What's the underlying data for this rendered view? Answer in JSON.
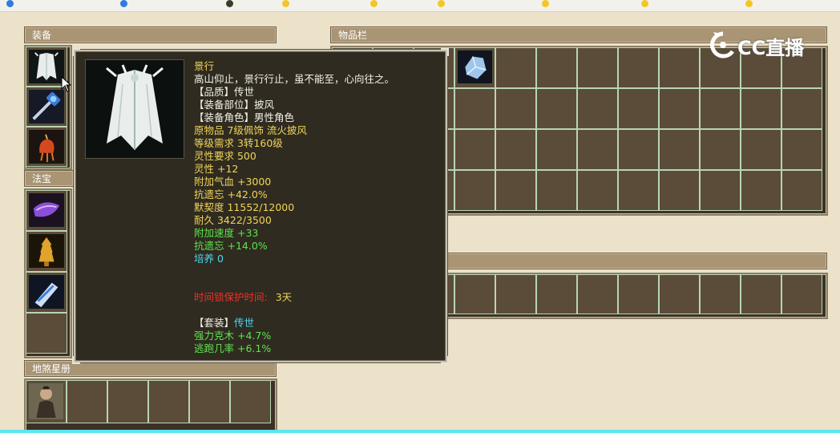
{
  "bookmarks": [
    "",
    "",
    "",
    "",
    "",
    "",
    "",
    "",
    "",
    ""
  ],
  "panels": {
    "equip_title": "装备",
    "fabao_title": "法宝",
    "disha_title": "地煞星册",
    "inventory_title": "物品栏"
  },
  "watermark": "CC直播",
  "tooltip": {
    "name": "景行",
    "desc": "高山仰止，景行行止，虽不能至，心向往之。",
    "quality": "【品质】传世",
    "slot": "【装备部位】披风",
    "role": "【装备角色】男性角色",
    "origin": "原物品 7级佩饰 流火披风",
    "level_req": "等级需求 3转160级",
    "lingxing_req": "灵性要求 500",
    "lingxing": "灵性 +12",
    "hp": "附加气血 +3000",
    "kang_yiwang": "抗遗忘 +42.0%",
    "moqi": "默契度 11552/12000",
    "naijiu": "耐久 3422/3500",
    "speed": "附加速度 +33",
    "kang_yiwang2": "抗遗忘 +14.0%",
    "peiyang": "培养 0",
    "lock_label": "时间锁保护时间:",
    "lock_value": "3天",
    "suit_label": "【套装】",
    "suit_value": "传世",
    "suit_attr1": "强力克木 +4.7%",
    "suit_attr2": "逃跑几率 +6.1%"
  },
  "colors": {
    "yellow": "#f2d45a",
    "white": "#f4f1e6",
    "green": "#5fe34f",
    "cyan": "#4fd7f0",
    "red": "#f0302a"
  },
  "icons": {
    "equip": [
      "cloak-icon",
      "hammer-icon",
      "lantern-icon"
    ],
    "fabao": [
      "scroll-icon",
      "tower-icon",
      "armguard-icon"
    ],
    "disha": [
      "warrior-portrait-icon"
    ],
    "inventory": [
      "crystal-icon"
    ]
  }
}
